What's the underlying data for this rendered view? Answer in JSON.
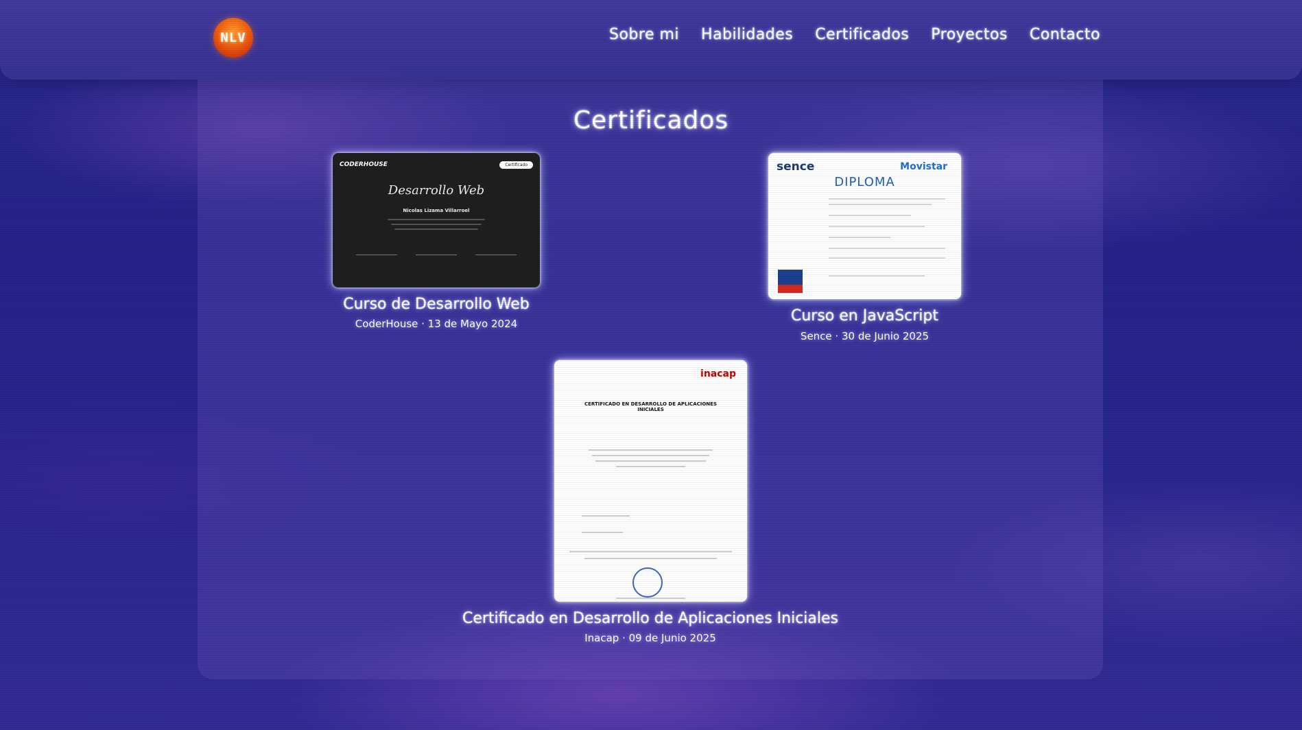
{
  "navbar": {
    "logo_text": "NLV",
    "links": [
      "Sobre mi",
      "Habilidades",
      "Certificados",
      "Proyectos",
      "Contacto"
    ]
  },
  "section": {
    "title": "Certificados"
  },
  "certificates": [
    {
      "title": "Curso de Desarrollo Web",
      "meta": "CoderHouse · 13 de Mayo 2024",
      "image": {
        "brand": "CODERHOUSE",
        "badge": "Certificado",
        "heading": "Desarrollo Web",
        "recipient": "Nicolas Lizama Villarroel"
      }
    },
    {
      "title": "Curso en JavaScript",
      "meta": "Sence · 30 de Junio 2025",
      "image": {
        "brand": "sence",
        "heading": "DIPLOMA",
        "partner": "Movistar"
      }
    },
    {
      "title": "Certificado en Desarrollo de Aplicaciones Iniciales",
      "meta": "Inacap · 09 de Junio 2025",
      "image": {
        "brand": "inacap",
        "heading": "CERTIFICADO EN DESARROLLO DE APLICACIONES INICIALES"
      }
    }
  ],
  "colors": {
    "accent_orange": "#f06010",
    "background": "#2a2a8c",
    "glow": "#c8c8ff"
  }
}
